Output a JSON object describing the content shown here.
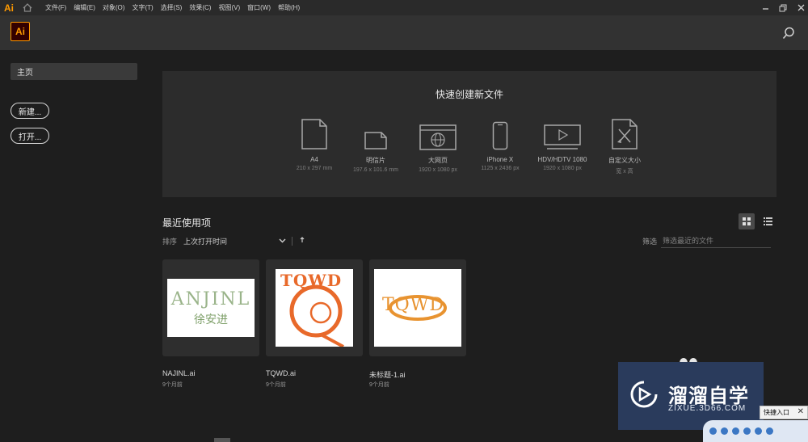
{
  "menubar": {
    "app_logo": "Ai",
    "items": [
      "文件(F)",
      "编辑(E)",
      "对象(O)",
      "文字(T)",
      "选择(S)",
      "效果(C)",
      "视图(V)",
      "窗口(W)",
      "帮助(H)"
    ]
  },
  "header": {
    "logo": "Ai"
  },
  "sidebar": {
    "home": "主页",
    "new_button": "新建...",
    "open_button": "打开..."
  },
  "quick_create": {
    "title": "快速创建新文件",
    "presets": [
      {
        "name": "A4",
        "size": "210 x 297 mm",
        "icon": "document-icon"
      },
      {
        "name": "明信片",
        "size": "197.6 x 101.6 mm",
        "icon": "postcard-icon"
      },
      {
        "name": "大网页",
        "size": "1920 x 1080 px",
        "icon": "web-page-icon"
      },
      {
        "name": "iPhone X",
        "size": "1125 x 2436 px",
        "icon": "phone-icon"
      },
      {
        "name": "HDV/HDTV 1080",
        "size": "1920 x 1080 px",
        "icon": "video-icon"
      },
      {
        "name": "自定义大小",
        "size": "宽 x 高",
        "icon": "custom-size-icon"
      }
    ]
  },
  "recent": {
    "title": "最近使用项",
    "sort_label": "排序",
    "sort_value": "上次打开时间",
    "filter_label": "筛选",
    "filter_placeholder": "筛选最近的文件",
    "files": [
      {
        "name": "NAJINL.ai",
        "date": "9个月前",
        "thumb_text": "ANJINL",
        "thumb_sub": "徐安进"
      },
      {
        "name": "TQWD.ai",
        "date": "9个月前",
        "thumb_text": "TQWD"
      },
      {
        "name": "未标题-1.ai",
        "date": "9个月前",
        "thumb_text": "TQWD"
      }
    ]
  },
  "watermark": {
    "name": "溜溜自学",
    "url": "ZIXUE.3D66.COM"
  },
  "quick_entry": {
    "label": "快捷入口"
  },
  "colors": {
    "accent": "#ff9a00",
    "background": "#1e1e1e",
    "panel": "#2c2c2c",
    "thumb_orange": "#e8692a"
  }
}
